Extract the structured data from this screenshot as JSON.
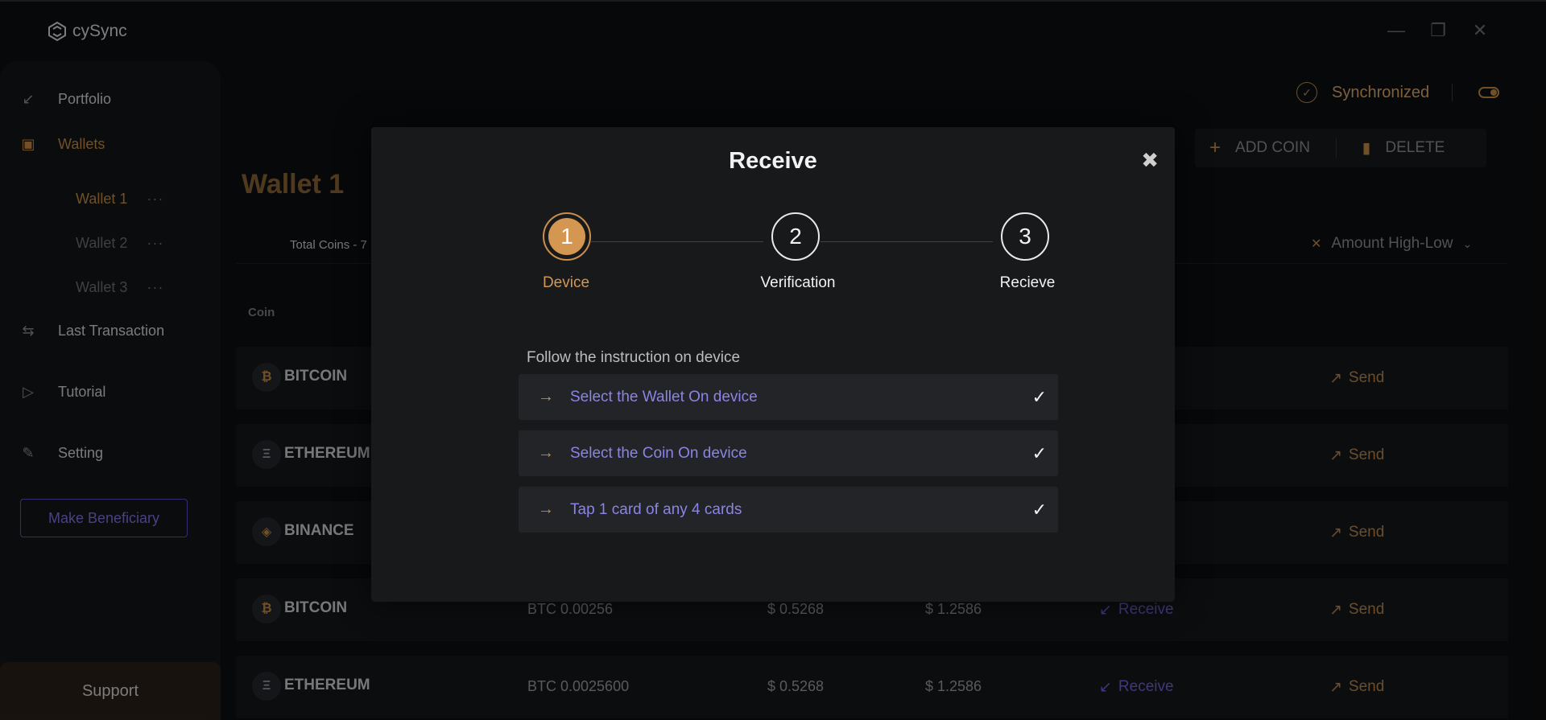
{
  "app": {
    "title": "cySync"
  },
  "window": {
    "minimize": "—",
    "maximize": "❐",
    "close": "✕"
  },
  "sidebar": {
    "portfolio": "Portfolio",
    "wallets": "Wallets",
    "wallet_items": [
      {
        "label": "Wallet 1",
        "more": "···",
        "active": true
      },
      {
        "label": "Wallet 2",
        "more": "···",
        "active": false
      },
      {
        "label": "Wallet 3",
        "more": "···",
        "active": false
      }
    ],
    "last_transaction": "Last Transaction",
    "tutorial": "Tutorial",
    "setting": "Setting",
    "make_beneficiary": "Make Beneficiary",
    "support": "Support"
  },
  "header": {
    "sync_status": "Synchronized",
    "add_coin": "ADD COIN",
    "delete": "DELETE"
  },
  "main": {
    "wallet_title": "Wallet 1",
    "total_coins": "Total Coins - 7",
    "sort_label": "Amount High-Low",
    "coin_column": "Coin",
    "rows": [
      {
        "symbol": "₿",
        "coin": "BITCOIN",
        "amount": "",
        "usd": "",
        "value": "",
        "receive": "",
        "send": "Send"
      },
      {
        "symbol": "Ξ",
        "coin": "ETHEREUM",
        "amount": "",
        "usd": "",
        "value": "",
        "receive": "",
        "send": "Send"
      },
      {
        "symbol": "◈",
        "coin": "BINANCE",
        "amount": "",
        "usd": "",
        "value": "",
        "receive": "",
        "send": "Send"
      },
      {
        "symbol": "₿",
        "coin": "BITCOIN",
        "amount": "BTC 0.00256",
        "usd": "$ 0.5268",
        "value": "$ 1.2586",
        "receive": "Receive",
        "send": "Send"
      },
      {
        "symbol": "Ξ",
        "coin": "ETHEREUM",
        "amount": "BTC 0.0025600",
        "usd": "$ 0.5268",
        "value": "$ 1.2586",
        "receive": "Receive",
        "send": "Send"
      }
    ]
  },
  "modal": {
    "title": "Receive",
    "close": "✖",
    "steps": [
      {
        "number": "1",
        "label": "Device",
        "active": true
      },
      {
        "number": "2",
        "label": "Verification",
        "active": false
      },
      {
        "number": "3",
        "label": "Recieve",
        "active": false
      }
    ],
    "instruction_heading": "Follow the instruction on device",
    "instructions": [
      {
        "arrow": "→",
        "text": "Select the Wallet On device",
        "check": "✓"
      },
      {
        "arrow": "→",
        "text": "Select the Coin On device",
        "check": "✓"
      },
      {
        "arrow": "→",
        "text": "Tap 1 card of any 4 cards",
        "check": "✓"
      }
    ]
  },
  "colors": {
    "accent": "#d39751",
    "link": "#8b84e6",
    "background": "#0d0e10",
    "modal": "#18191b"
  }
}
